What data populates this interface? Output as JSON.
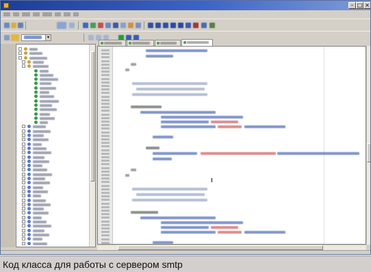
{
  "window": {
    "title": "",
    "title_bar_color": "#1e3c96"
  },
  "menubar": {
    "items": [
      "",
      "",
      "",
      "",
      "",
      "",
      "",
      ""
    ]
  },
  "toolbar": {
    "dropdown_value": ""
  },
  "project_tree": {
    "item_count": 46
  },
  "editor": {
    "tab_count": 4,
    "keyword_color": "#1a3fa0",
    "string_color": "#c03030",
    "comment_color": "#7a8ab0"
  },
  "caption": {
    "text": "Код класса для работы с сервером smtp"
  }
}
